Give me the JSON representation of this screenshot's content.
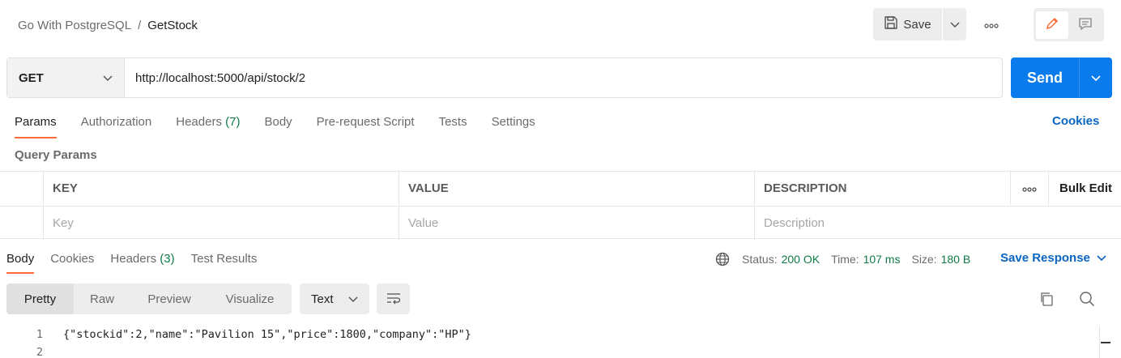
{
  "header": {
    "collection": "Go With PostgreSQL",
    "separator": "/",
    "request_name": "GetStock",
    "save_label": "Save"
  },
  "request": {
    "method": "GET",
    "url": "http://localhost:5000/api/stock/2",
    "send_label": "Send"
  },
  "request_tabs": [
    {
      "label": "Params",
      "active": true
    },
    {
      "label": "Authorization"
    },
    {
      "label": "Headers",
      "count": "(7)"
    },
    {
      "label": "Body"
    },
    {
      "label": "Pre-request Script"
    },
    {
      "label": "Tests"
    },
    {
      "label": "Settings"
    }
  ],
  "cookies_link": "Cookies",
  "query_params": {
    "title": "Query Params",
    "columns": {
      "key": "KEY",
      "value": "VALUE",
      "description": "DESCRIPTION"
    },
    "bulk_edit": "Bulk Edit",
    "placeholders": {
      "key": "Key",
      "value": "Value",
      "description": "Description"
    }
  },
  "response_tabs": [
    {
      "label": "Body",
      "active": true
    },
    {
      "label": "Cookies"
    },
    {
      "label": "Headers",
      "count": "(3)"
    },
    {
      "label": "Test Results"
    }
  ],
  "response_status": {
    "status_label": "Status:",
    "status_value": "200 OK",
    "time_label": "Time:",
    "time_value": "107 ms",
    "size_label": "Size:",
    "size_value": "180 B",
    "save_response": "Save Response"
  },
  "view_modes": [
    "Pretty",
    "Raw",
    "Preview",
    "Visualize"
  ],
  "format": "Text",
  "response_body": {
    "lines": [
      {
        "num": "1",
        "code": "{\"stockid\":2,\"name\":\"Pavilion 15\",\"price\":1800,\"company\":\"HP\"}"
      },
      {
        "num": "2",
        "code": ""
      }
    ]
  },
  "colors": {
    "accent": "#ff6c37",
    "send": "#097bed",
    "link": "#0a65c2",
    "success": "#0f7b46"
  }
}
